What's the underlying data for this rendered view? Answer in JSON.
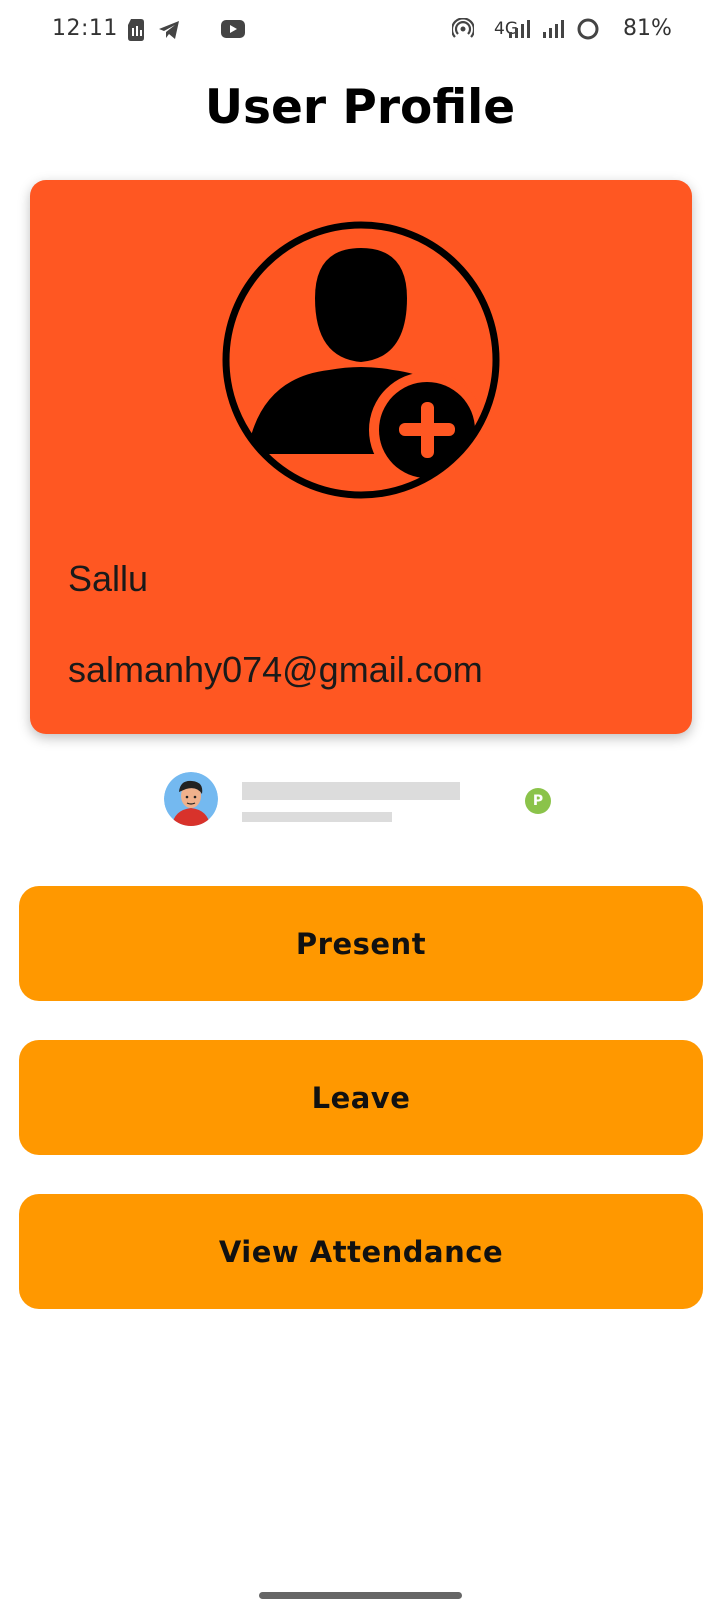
{
  "status_bar": {
    "time": "12:11",
    "network_label": "4G",
    "battery_text": "81%",
    "icons": [
      "sim-card-icon",
      "telegram-icon",
      "youtube-icon",
      "hotspot-icon",
      "signal-icon",
      "signal-icon",
      "battery-ring-icon"
    ]
  },
  "page": {
    "title": "User Profile"
  },
  "profile": {
    "name": "Sallu",
    "email": "salmanhy074@gmail.com",
    "avatar_icon": "add-user-icon"
  },
  "ad": {
    "badge_letter": "P"
  },
  "buttons": {
    "present": "Present",
    "leave": "Leave",
    "view_attendance": "View Attendance"
  },
  "colors": {
    "card_background": "#ff5722",
    "button_background": "#ff9800",
    "badge_green": "#8bc34a",
    "placeholder_gray": "#dcdcdc"
  }
}
